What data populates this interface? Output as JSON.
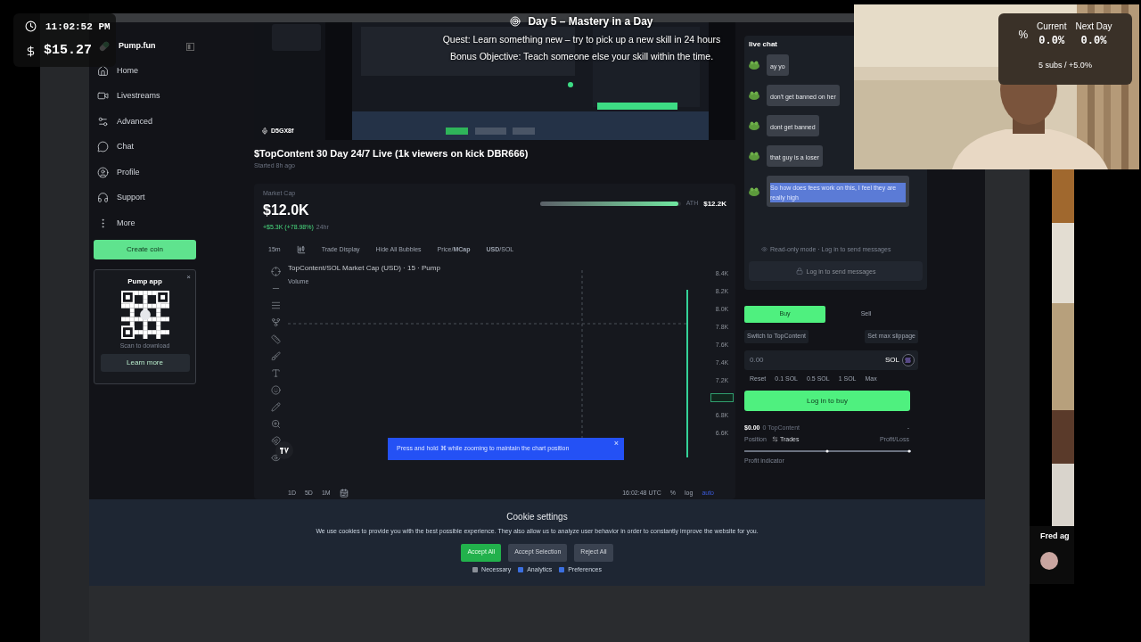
{
  "overlay": {
    "clock": "11:02:52 PM",
    "balance": "$15.27",
    "quest_title": "Day 5 – Mastery in a Day",
    "quest": "Quest: Learn something new – try to pick up a new skill in 24 hours",
    "bonus": "Bonus Objective: Teach someone else your skill within the time."
  },
  "webcam": {
    "kind": "picture",
    "symbol": "%",
    "stats": [
      {
        "label": "Current",
        "value": "0.0%"
      },
      {
        "label": "Next Day",
        "value": "0.0%"
      }
    ],
    "subs": "5 subs / +5.0%"
  },
  "side_video": {
    "kind": "picture",
    "name": "Fred ag"
  },
  "sidebar": {
    "brand": "Pump.fun",
    "items": [
      {
        "label": "Home"
      },
      {
        "label": "Livestreams"
      },
      {
        "label": "Advanced"
      },
      {
        "label": "Chat"
      },
      {
        "label": "Profile"
      },
      {
        "label": "Support"
      },
      {
        "label": "More"
      }
    ],
    "create_button": "Create coin",
    "app_card": {
      "title": "Pump app",
      "close": "×",
      "caption": "Scan to download",
      "button": "Learn more"
    }
  },
  "stream": {
    "kind": "picture",
    "host": "D5GX8f",
    "title": "$TopContent 30 Day 24/7 Live (1k viewers on kick DBR666)",
    "started": "Started 8h ago"
  },
  "market": {
    "label": "Market Cap",
    "value": "$12.0K",
    "change": "+$5.3K (+78.98%)",
    "period": "24hr",
    "ath_label": "ATH",
    "ath_value": "$12.2K",
    "level": 0.98
  },
  "chart_toolbar": [
    {
      "label": "15m"
    },
    {
      "label": "Trade Display"
    },
    {
      "label": "Hide All Bubbles"
    },
    {
      "label": "Price/**MCap**"
    },
    {
      "label": "**USD**/SOL"
    }
  ],
  "chart": {
    "header": "TopContent/SOL Market Cap (USD) · 15 · Pump",
    "volume": "Volume",
    "y_labels": [
      {
        "kind": "label",
        "text": "8.4K"
      },
      {
        "kind": "label",
        "text": "8.2K"
      },
      {
        "kind": "label",
        "text": "8.0K"
      },
      {
        "kind": "label",
        "text": "7.8K"
      },
      {
        "kind": "label",
        "text": "7.6K"
      },
      {
        "kind": "label",
        "text": "7.4K"
      },
      {
        "kind": "label",
        "text": "7.2K"
      },
      {
        "kind": "tag"
      },
      {
        "kind": "label",
        "text": "6.8K"
      },
      {
        "kind": "label",
        "text": "6.6K"
      }
    ],
    "toast": "Press and hold ⌘ while zooming to maintain the chart position",
    "toast_close": "×",
    "ranges": [
      "1D",
      "5D",
      "1M"
    ],
    "time": "16:02:48 UTC",
    "scale_options": [
      {
        "label": "%",
        "selected": false
      },
      {
        "label": "log",
        "selected": false
      },
      {
        "label": "auto",
        "selected": true
      }
    ]
  },
  "chat": {
    "title": "live chat",
    "messages": [
      {
        "text": "ay yo",
        "highlighted": false
      },
      {
        "text": "don't get banned on her",
        "highlighted": false
      },
      {
        "text": "dont get banned",
        "highlighted": false
      },
      {
        "text": "that guy is a loser",
        "highlighted": false
      },
      {
        "text": "So how does fees work on this, I feel they are really high",
        "highlighted": true
      }
    ],
    "notice": "Read-only mode · Log in to send messages",
    "login_button": "Log in to send messages"
  },
  "trade": {
    "tabs": [
      {
        "label": "Buy",
        "selected": true
      },
      {
        "label": "Sell",
        "selected": false
      }
    ],
    "switch": "Switch to TopContent",
    "slippage": "Set max slippage",
    "amount_placeholder": "0.00",
    "currency": "SOL",
    "quick": [
      "Reset",
      "0.1 SOL",
      "0.5 SOL",
      "1 SOL",
      "Max"
    ],
    "submit": "Log in to buy",
    "position_value": "$0.00",
    "position_amount": "0 TopContent",
    "dash": "-",
    "position_tabs": [
      {
        "label": "Position",
        "selected": false
      },
      {
        "label": "Trades",
        "selected": true
      }
    ],
    "pnl": "Profit/Loss",
    "profit_label": "Profit indicator"
  },
  "cookies": {
    "title": "Cookie settings",
    "text": "We use cookies to provide you with the best possible experience. They also allow us to analyze user behavior in order to constantly improve the website for you.",
    "buttons": [
      {
        "label": "Accept All",
        "kind": "primary"
      },
      {
        "label": "Accept Selection",
        "kind": "secondary"
      },
      {
        "label": "Reject All",
        "kind": "secondary"
      }
    ],
    "options": [
      {
        "label": "Necessary",
        "checked": false
      },
      {
        "label": "Analytics",
        "checked": true
      },
      {
        "label": "Preferences",
        "checked": true
      }
    ]
  }
}
